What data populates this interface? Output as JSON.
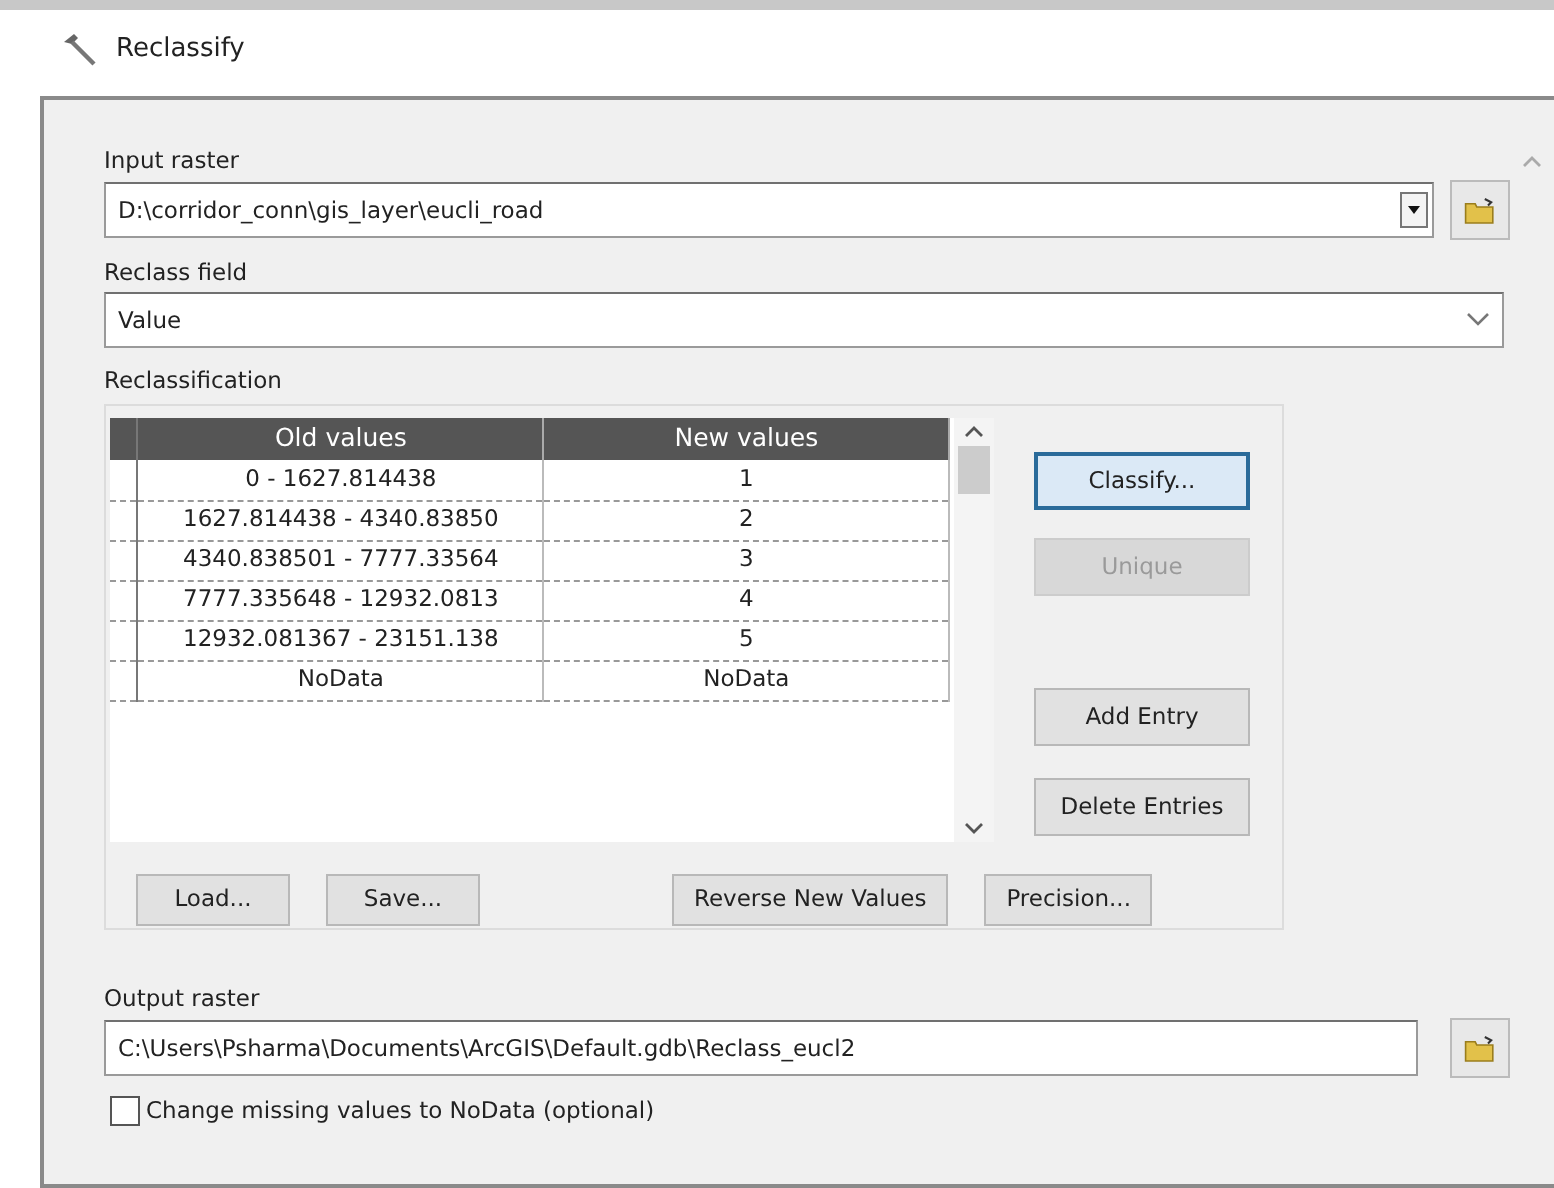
{
  "window": {
    "title": "Reclassify"
  },
  "input_raster": {
    "label": "Input raster",
    "value": "D:\\corridor_conn\\gis_layer\\eucli_road"
  },
  "reclass_field": {
    "label": "Reclass field",
    "value": "Value"
  },
  "reclassification": {
    "label": "Reclassification",
    "columns": [
      "Old values",
      "New values"
    ],
    "rows": [
      {
        "old": "0 - 1627.814438",
        "new": "1"
      },
      {
        "old": "1627.814438 - 4340.83850",
        "new": "2"
      },
      {
        "old": "4340.838501 - 7777.33564",
        "new": "3"
      },
      {
        "old": "7777.335648 - 12932.0813",
        "new": "4"
      },
      {
        "old": "12932.081367 - 23151.138",
        "new": "5"
      },
      {
        "old": "NoData",
        "new": "NoData"
      }
    ],
    "side_buttons": [
      [
        {
          "label": "Classify...",
          "default": true,
          "disabled": false
        },
        {
          "label": "Unique",
          "default": false,
          "disabled": true
        }
      ],
      [
        {
          "label": "Add Entry",
          "default": false,
          "disabled": false
        },
        {
          "label": "Delete Entries",
          "default": false,
          "disabled": false
        }
      ]
    ],
    "bottom_buttons": [
      [
        {
          "label": "Load...",
          "disabled": false
        },
        {
          "label": "Save...",
          "disabled": false
        }
      ],
      [
        {
          "label": "Reverse New Values",
          "disabled": false
        },
        {
          "label": "Precision...",
          "disabled": false
        }
      ]
    ]
  },
  "output_raster": {
    "label": "Output raster",
    "value": "C:\\Users\\Psharma\\Documents\\ArcGIS\\Default.gdb\\Reclass_eucl2"
  },
  "change_missing": {
    "label": "Change missing values to NoData (optional)",
    "checked": false
  }
}
